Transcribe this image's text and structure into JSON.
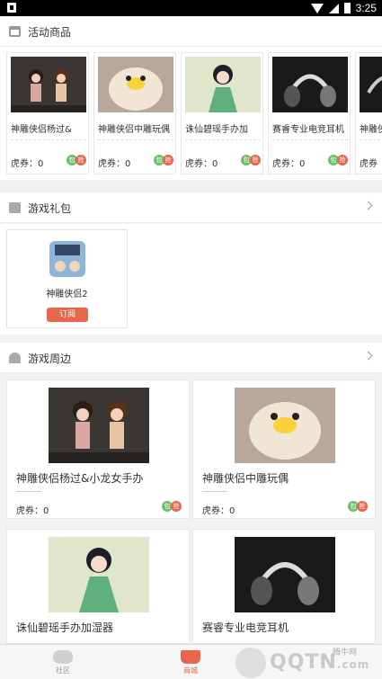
{
  "status_bar": {
    "time": "3:25"
  },
  "activity": {
    "title": "活动商品",
    "items": [
      {
        "name": "神雕侠侣杨过&",
        "price_label": "虎券：",
        "price": "0",
        "badge_a": "包",
        "badge_b": "抢"
      },
      {
        "name": "神雕侠侣中雕玩偶",
        "price_label": "虎券：",
        "price": "0",
        "badge_a": "包",
        "badge_b": "抢"
      },
      {
        "name": "诛仙碧瑶手办加",
        "price_label": "虎券：",
        "price": "0",
        "badge_a": "包",
        "badge_b": "抢"
      },
      {
        "name": "赛睿专业电竞耳机",
        "price_label": "虎券：",
        "price": "0",
        "badge_a": "包",
        "badge_b": "抢"
      },
      {
        "name": "神雕侠",
        "price_label": "虎券",
        "price": "",
        "badge_a": "",
        "badge_b": ""
      }
    ]
  },
  "gifts": {
    "title": "游戏礼包",
    "items": [
      {
        "name": "神雕侠侣2",
        "button": "订阅"
      }
    ]
  },
  "merch": {
    "title": "游戏周边",
    "items": [
      {
        "name": "神雕侠侣杨过&小龙女手办",
        "price_label": "虎券：",
        "price": "0",
        "badge_a": "包",
        "badge_b": "抢"
      },
      {
        "name": "神雕侠侣中雕玩偶",
        "price_label": "虎券：",
        "price": "0",
        "badge_a": "包",
        "badge_b": "抢"
      },
      {
        "name": "诛仙碧瑶手办加湿器",
        "price_label": "",
        "price": "",
        "badge_a": "",
        "badge_b": ""
      },
      {
        "name": "赛睿专业电竞耳机",
        "price_label": "",
        "price": "",
        "badge_a": "",
        "badge_b": ""
      }
    ]
  },
  "tabs": [
    {
      "label": "社区",
      "icon": "gamepad-icon",
      "active": false
    },
    {
      "label": "商城",
      "icon": "cart-icon",
      "active": true
    }
  ],
  "watermark": {
    "brand": "QQTN",
    "domain": ".com",
    "cn": "腾牛网"
  },
  "colors": {
    "accent": "#e9654b",
    "green": "#6cc06c"
  }
}
